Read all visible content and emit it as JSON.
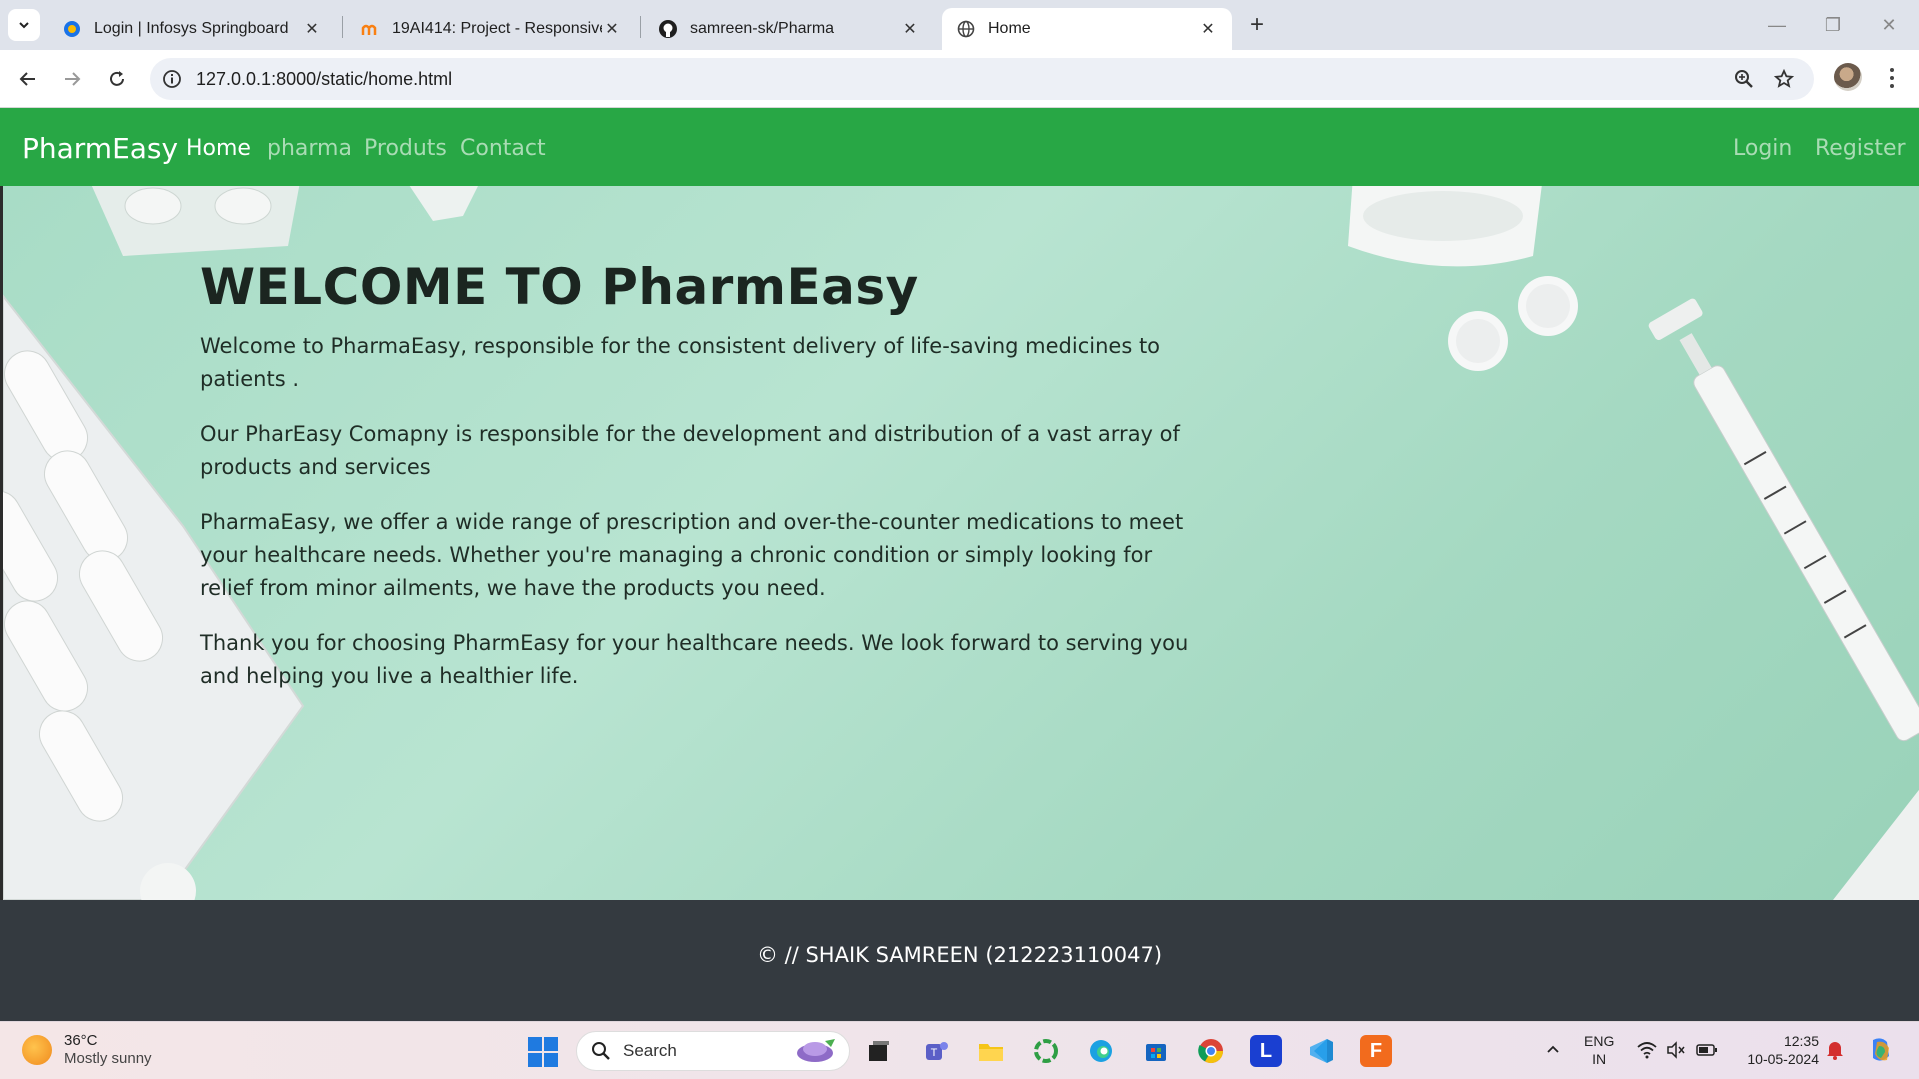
{
  "browser": {
    "tabs": [
      {
        "title": "Login | Infosys Springboard",
        "icon": "infosys-icon"
      },
      {
        "title": "19AI414: Project - Responsive W",
        "icon": "moodle-icon"
      },
      {
        "title": "samreen-sk/Pharma",
        "icon": "github-icon"
      },
      {
        "title": "Home",
        "icon": "globe-icon",
        "active": true
      }
    ],
    "url": "127.0.0.1:8000/static/home.html"
  },
  "navbar": {
    "brand": "PharmEasy",
    "links": [
      "Home",
      "pharma",
      "Produts",
      "Contact"
    ],
    "right_links": [
      "Login",
      "Register"
    ],
    "color": "#28a745"
  },
  "hero": {
    "title": "WELCOME TO PharmEasy",
    "paragraphs": [
      "Welcome to PharmaEasy, responsible for the consistent delivery of life-saving medicines to patients .",
      "Our PharEasy Comapny is responsible for the development and distribution of a vast array of products and services",
      "PharmaEasy, we offer a wide range of prescription and over-the-counter medications to meet your healthcare needs. Whether you're managing a chronic condition or simply looking for relief from minor ailments, we have the products you need.",
      "Thank you for choosing PharmEasy for your healthcare needs. We look forward to serving you and helping you live a healthier life."
    ]
  },
  "footer": {
    "text": "© // SHAIK SAMREEN (212223110047)",
    "color": "#343a40"
  },
  "taskbar": {
    "weather_temp": "36°C",
    "weather_desc": "Mostly sunny",
    "search_label": "Search",
    "lang_line1": "ENG",
    "lang_line2": "IN",
    "time": "12:35",
    "date": "10-05-2024"
  }
}
